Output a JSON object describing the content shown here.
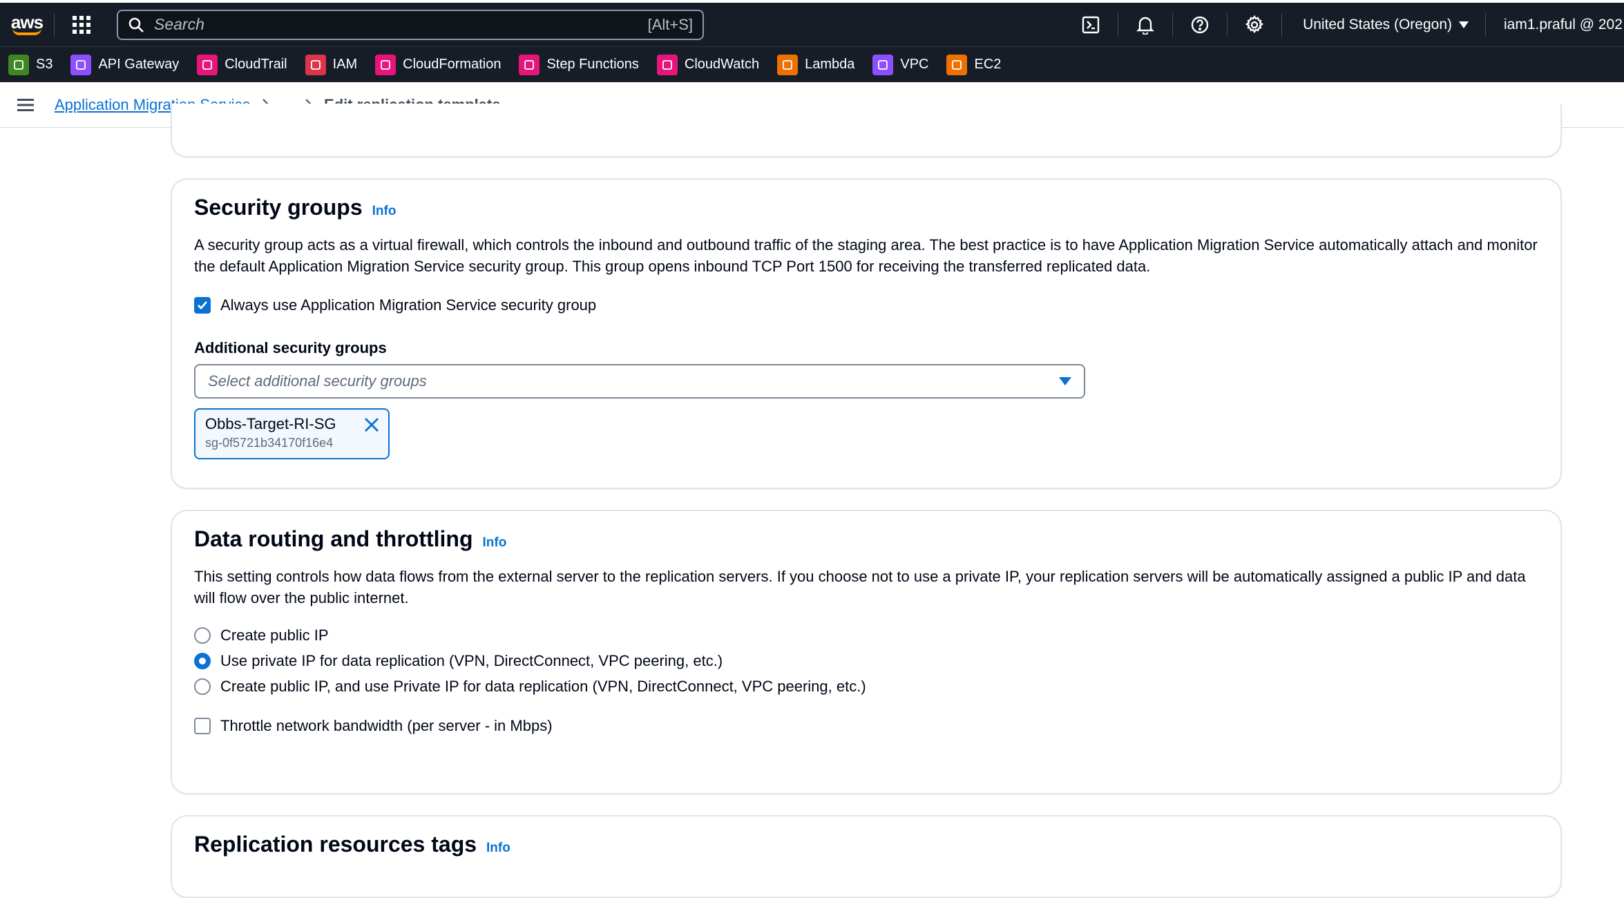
{
  "topnav": {
    "logo_text": "aws",
    "search_placeholder": "Search",
    "search_shortcut": "[Alt+S]",
    "region": "United States (Oregon)",
    "account": "iam1.praful @ 202"
  },
  "favorites": [
    {
      "label": "S3",
      "color": "#3f8624"
    },
    {
      "label": "API Gateway",
      "color": "#8c4fff"
    },
    {
      "label": "CloudTrail",
      "color": "#e7157b"
    },
    {
      "label": "IAM",
      "color": "#dd344c"
    },
    {
      "label": "CloudFormation",
      "color": "#e7157b"
    },
    {
      "label": "Step Functions",
      "color": "#e7157b"
    },
    {
      "label": "CloudWatch",
      "color": "#e7157b"
    },
    {
      "label": "Lambda",
      "color": "#ed7100"
    },
    {
      "label": "VPC",
      "color": "#8c4fff"
    },
    {
      "label": "EC2",
      "color": "#ed7100"
    }
  ],
  "breadcrumb": {
    "root": "Application Migration Service",
    "ellipsis": "...",
    "current": "Edit replication template"
  },
  "security_groups": {
    "title": "Security groups",
    "info": "Info",
    "description": "A security group acts as a virtual firewall, which controls the inbound and outbound traffic of the staging area. The best practice is to have Application Migration Service automatically attach and monitor the default Application Migration Service security group. This group opens inbound TCP Port 1500 for receiving the transferred replicated data.",
    "always_use_label": "Always use Application Migration Service security group",
    "always_use_checked": true,
    "additional_label": "Additional security groups",
    "additional_placeholder": "Select additional security groups",
    "token_name": "Obbs-Target-RI-SG",
    "token_id": "sg-0f5721b34170f16e4"
  },
  "data_routing": {
    "title": "Data routing and throttling",
    "info": "Info",
    "description": "This setting controls how data flows from the external server to the replication servers. If you choose not to use a private IP, your replication servers will be automatically assigned a public IP and data will flow over the public internet.",
    "options": [
      {
        "label": "Create public IP",
        "selected": false
      },
      {
        "label": "Use private IP for data replication (VPN, DirectConnect, VPC peering, etc.)",
        "selected": true
      },
      {
        "label": "Create public IP, and use Private IP for data replication (VPN, DirectConnect, VPC peering, etc.)",
        "selected": false
      }
    ],
    "throttle_label": "Throttle network bandwidth (per server - in Mbps)",
    "throttle_checked": false
  },
  "replication_tags": {
    "title": "Replication resources tags",
    "info": "Info"
  }
}
